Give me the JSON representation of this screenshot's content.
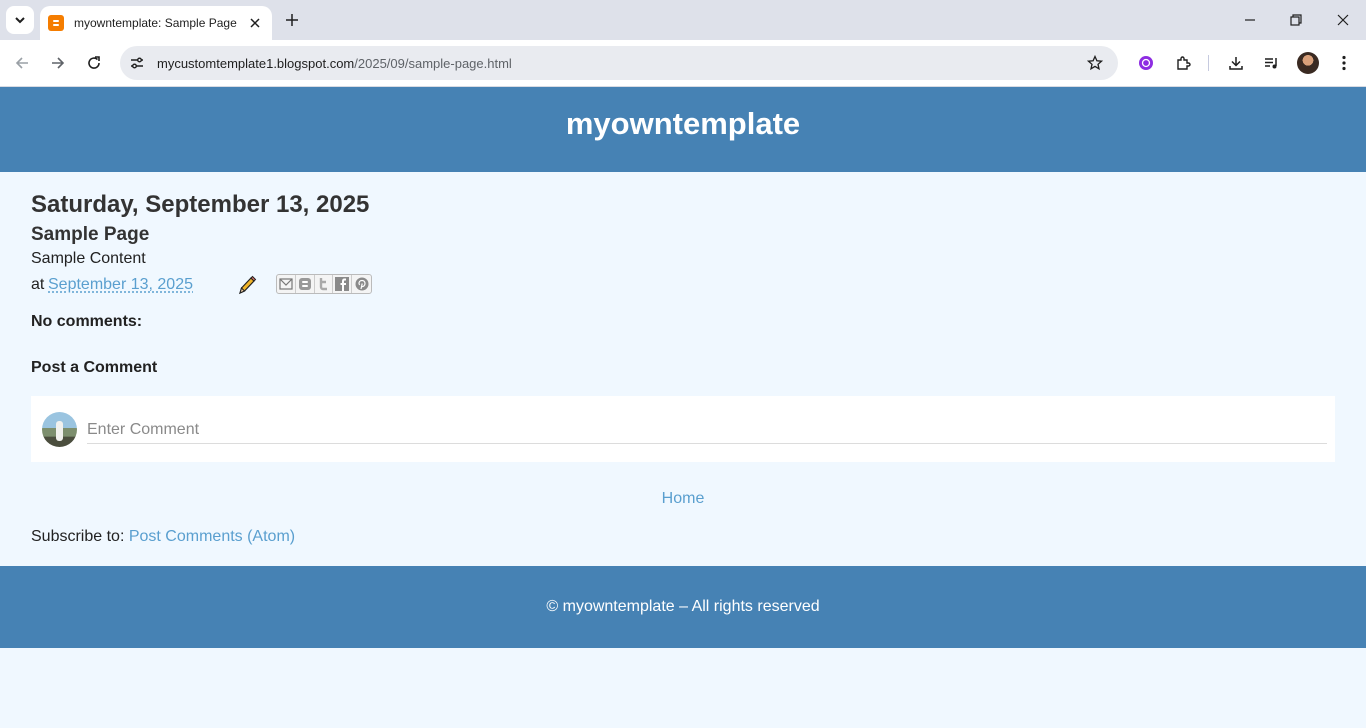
{
  "browser": {
    "tab_title": "myowntemplate: Sample Page",
    "url_host": "mycustomtemplate1.blogspot.com",
    "url_path": "/2025/09/sample-page.html",
    "icons": [
      "tab-search-icon",
      "blogger-favicon-icon",
      "close-icon",
      "plus-icon",
      "minimize-icon",
      "restore-icon",
      "back-icon",
      "forward-icon",
      "reload-icon",
      "site-settings-icon",
      "star-icon",
      "extension-purple-icon",
      "puzzle-icon",
      "download-icon",
      "media-icon",
      "avatar",
      "more-icon"
    ]
  },
  "header": {
    "title": "myowntemplate"
  },
  "post": {
    "date_header": "Saturday, September 13, 2025",
    "title": "Sample Page",
    "body": "Sample Content",
    "at_label": "at",
    "timestamp": "September 13, 2025"
  },
  "comments": {
    "count_label": "No comments:",
    "post_title": "Post a Comment",
    "input_placeholder": "Enter Comment"
  },
  "nav": {
    "home_label": "Home"
  },
  "subscribe": {
    "label": "Subscribe to:",
    "link": "Post Comments (Atom)"
  },
  "footer": {
    "text": "© myowntemplate – All rights reserved"
  },
  "colors": {
    "header_bg": "#4682b4",
    "page_bg": "#f0f8ff",
    "link": "#5a9fcf"
  }
}
